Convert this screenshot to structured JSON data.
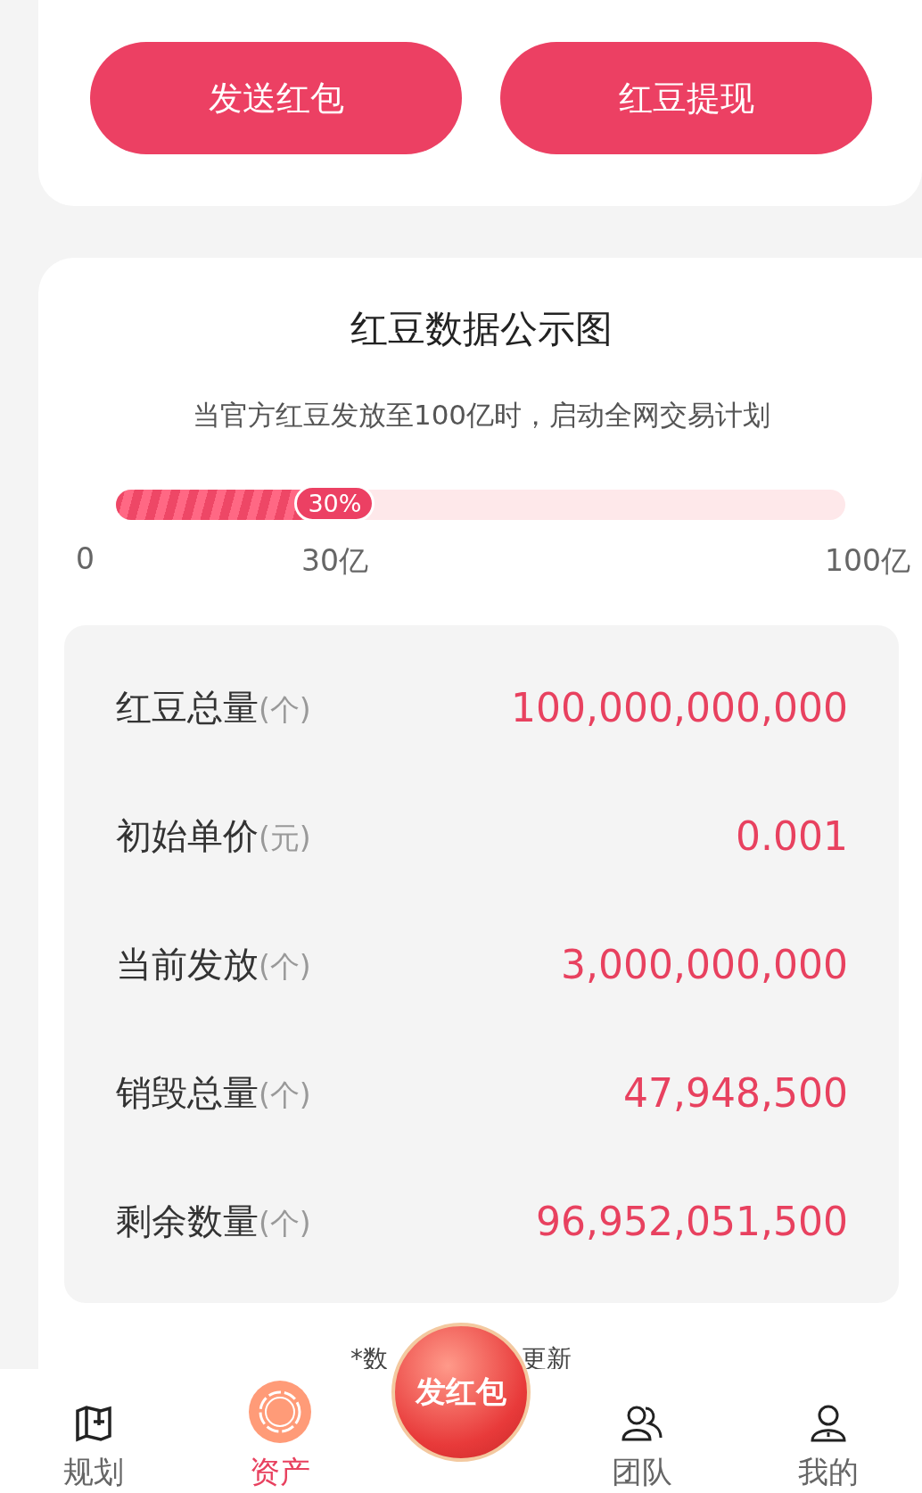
{
  "actions": [
    {
      "label": "发送红包"
    },
    {
      "label": "红豆提现"
    }
  ],
  "panel": {
    "title": "红豆数据公示图",
    "subtitle": "当官方红豆发放至100亿时，启动全网交易计划",
    "progress": {
      "level": 0.3,
      "badge": "30%",
      "start_label": "0",
      "current_label": "30亿",
      "end_label": "100亿"
    },
    "stats": [
      {
        "label": "红豆总量",
        "unit": "(个)",
        "value": "100,000,000,000"
      },
      {
        "label": "初始单价",
        "unit": "(元)",
        "value": "0.001"
      },
      {
        "label": "当前发放",
        "unit": "(个)",
        "value": "3,000,000,000"
      },
      {
        "label": "销毁总量",
        "unit": "(个)",
        "value": "47,948,500"
      },
      {
        "label": "剩余数量",
        "unit": "(个)",
        "value": "96,952,051,500"
      }
    ],
    "note_fragments": [
      "*数",
      "更新"
    ]
  },
  "tab_bar": {
    "items": [
      {
        "label": "规划",
        "kind": "map",
        "selected": false
      },
      {
        "label": "资产",
        "kind": "asset",
        "selected": true
      },
      {
        "label": "发红包",
        "kind": "center",
        "selected": false
      },
      {
        "label": "团队",
        "kind": "team",
        "selected": false
      },
      {
        "label": "我的",
        "kind": "user",
        "selected": false
      }
    ]
  }
}
